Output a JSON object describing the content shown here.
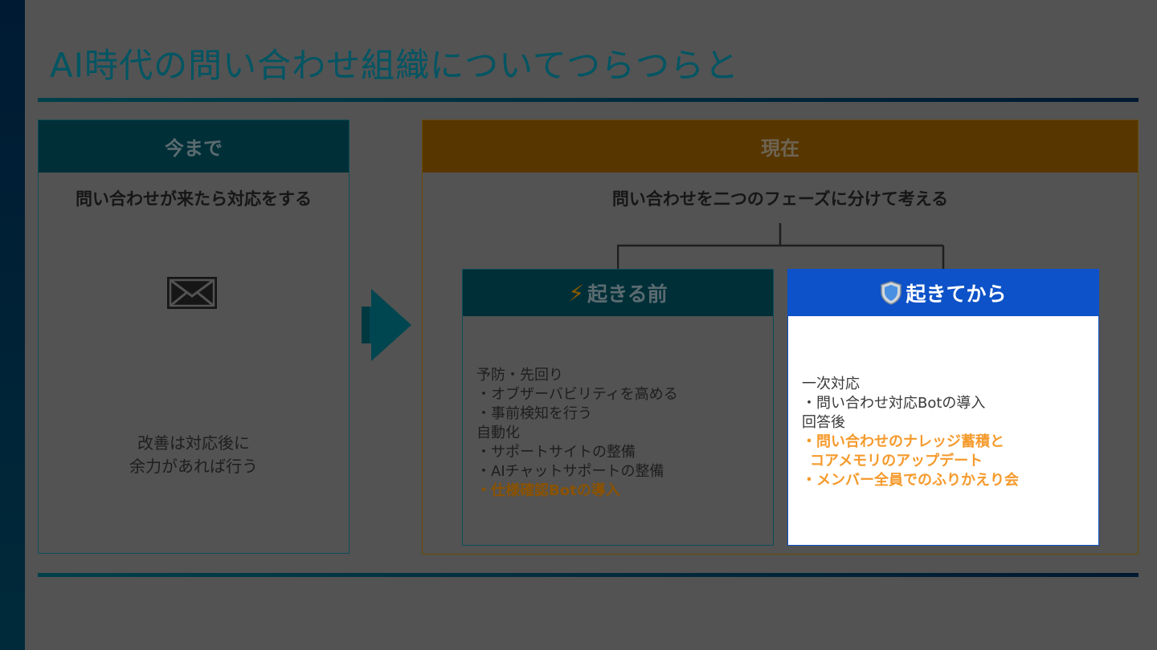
{
  "title": "AI時代の問い合わせ組織についてつらつらと",
  "left_panel": {
    "header": "今まで",
    "subtitle": "問い合わせが来たら対応をする",
    "icon": "envelope-icon",
    "note_line1": "改善は対応後に",
    "note_line2": "余力があれば行う"
  },
  "right_panel": {
    "header": "現在",
    "subtitle": "問い合わせを二つのフェーズに分けて考える",
    "before": {
      "icon": "lightning-icon",
      "icon_glyph": "⚡",
      "label": "起きる前",
      "lines": [
        "予防・先回り",
        "・オブザーバビリティを高める",
        "・事前検知を行う",
        "自動化",
        "・サポートサイトの整備",
        "・AIチャットサポートの整備"
      ],
      "highlight": "・仕様確認Botの導入"
    },
    "after": {
      "icon": "shield-icon",
      "label": "起きてから",
      "lines": [
        "一次対応",
        "・問い合わせ対応Botの導入",
        "回答後"
      ],
      "highlight_line1": "・問い合わせのナレッジ蓄積と",
      "highlight_line2": "コアメモリのアップデート",
      "highlight_line3": "・メンバー全員でのふりかえり会"
    }
  },
  "colors": {
    "background": "#535353",
    "teal_header": "#002f38",
    "brown_header": "#573600",
    "blue_header": "#0d52c8",
    "orange_highlight": "#f59a2c"
  }
}
